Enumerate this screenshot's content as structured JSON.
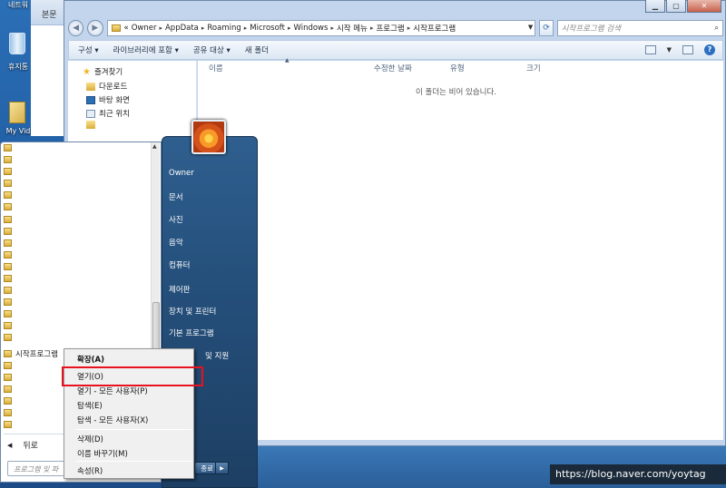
{
  "desktop": {
    "icons": [
      {
        "label": "휴지통",
        "icon": "recycle-bin-icon"
      },
      {
        "label": "My Vid",
        "icon": "file-icon"
      }
    ],
    "partial_top_label": "네트워",
    "back_window_tab": "본문"
  },
  "explorer": {
    "window_buttons": [
      "minimize",
      "maximize",
      "close"
    ],
    "address_crumbs": [
      "Owner",
      "AppData",
      "Roaming",
      "Microsoft",
      "Windows",
      "시작 메뉴",
      "프로그램",
      "시작프로그램"
    ],
    "address_prefix": "«",
    "search_placeholder": "시작프로그램 검색",
    "toolbar": {
      "organize": "구성 ▾",
      "include_library": "라이브러리에 포함 ▾",
      "share": "공유 대상 ▾",
      "new_folder": "새 폴더"
    },
    "nav": {
      "favorites": "즐겨찾기",
      "downloads": "다운로드",
      "desktop": "바탕 화면",
      "recent": "최근 위치"
    },
    "columns": [
      "이름",
      "수정한 날짜",
      "유형",
      "크기"
    ],
    "empty_message": "이 폴더는 비어 있습니다."
  },
  "startmenu": {
    "right_items": [
      "Owner",
      "문서",
      "사진",
      "음악",
      "컴퓨터",
      "제어판",
      "장치 및 프린터",
      "기본 프로그램",
      "및 지원"
    ],
    "selected_program": "시작프로그램",
    "back_label": "뒤로",
    "search_placeholder": "프로그램 및 파",
    "shutdown_label": "종료"
  },
  "context_menu": {
    "items": [
      {
        "label": "확장(A)",
        "bold": true
      },
      {
        "label": "열기(O)",
        "bold": false
      },
      {
        "label": "열기 - 모든 사용자(P)",
        "bold": false
      },
      {
        "label": "탐색(E)",
        "bold": false
      },
      {
        "label": "탐색 - 모든 사용자(X)",
        "bold": false
      },
      {
        "label": "삭제(D)",
        "bold": false
      },
      {
        "label": "이름 바꾸기(M)",
        "bold": false
      },
      {
        "label": "속성(R)",
        "bold": false
      }
    ]
  },
  "watermark": "https://blog.naver.com/yoytag",
  "colors": {
    "highlight": "#e8121f",
    "start_menu_right": "#25507c",
    "desktop": "#1f5da3"
  }
}
